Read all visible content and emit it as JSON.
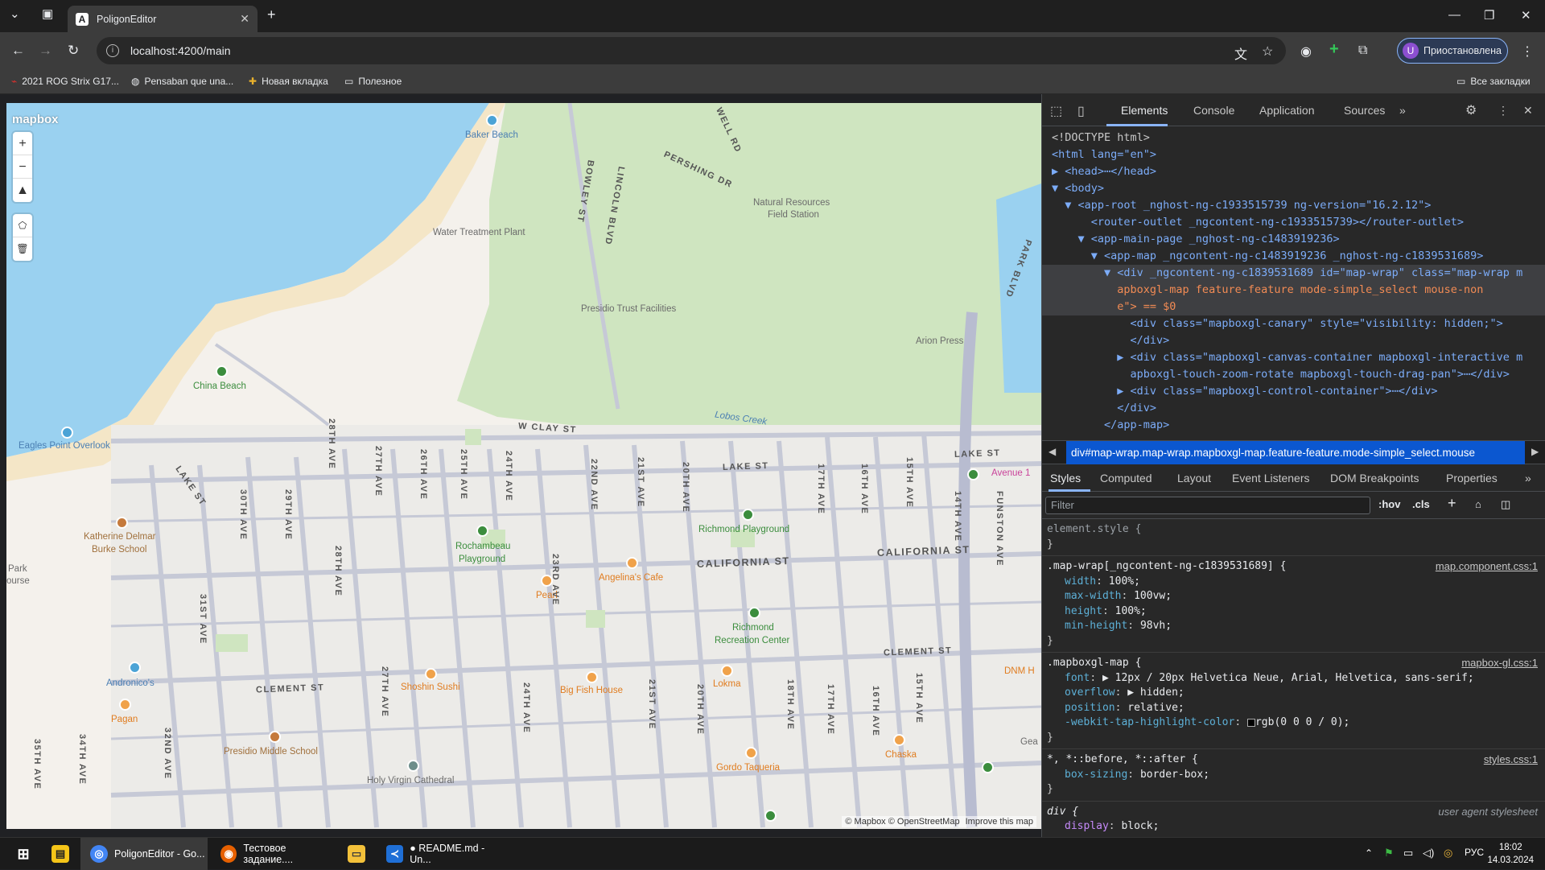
{
  "browser": {
    "tab_title": "PoligonEditor",
    "address": "localhost:4200/main",
    "profile_label": "Приостановлена",
    "profile_initial": "U",
    "bookmarks": [
      "2021 ROG Strix G17...",
      "Pensaban que una...",
      "Новая вкладка",
      "Полезное"
    ],
    "all_bookmarks": "Все закладки"
  },
  "map": {
    "logo": "mapbox",
    "attribution": "© Mapbox © OpenStreetMap",
    "improve": "Improve this map",
    "places": [
      "Baker Beach",
      "Water Treatment Plant",
      "Natural Resources",
      "Field Station",
      "Presidio Trust Facilities",
      "Arion Press",
      "China Beach",
      "Lobos Creek",
      "Eagles Point Overlook",
      "Katherine Delmar",
      "Burke School",
      "Rochambeau",
      "Playground",
      "Richmond Playground",
      "Angelina's Cafe",
      "Pearl",
      "Richmond",
      "Recreation Center",
      "Andronico's",
      "Pagan",
      "Shoshin Sushi",
      "Big Fish House",
      "Lokma",
      "Chaska",
      "Presidio Middle School",
      "Holy Virgin Cathedral",
      "Gordo Taqueria",
      "Avenue 1",
      "DNM H",
      "Park",
      "ourse",
      "Gea"
    ],
    "streets_h": [
      "W CLAY ST",
      "LAKE ST",
      "LAKE ST",
      "CALIFORNIA ST",
      "CALIFORNIA ST",
      "CLEMENT ST",
      "CLEMENT ST",
      "LAKE ST"
    ],
    "streets_v": [
      "LINCOLN BLVD",
      "BOWLEY ST",
      "PERSHING DR",
      "WELL RD",
      "PARK BLVD",
      "28TH AVE",
      "27TH AVE",
      "26TH AVE",
      "25TH AVE",
      "24TH AVE",
      "22ND AVE",
      "21ST AVE",
      "20TH AVE",
      "17TH AVE",
      "16TH AVE",
      "15TH AVE",
      "14TH AVE",
      "FUNSTON AVE",
      "30TH AVE",
      "29TH AVE",
      "28TH AVE",
      "23RD AVE",
      "31ST AVE",
      "27TH AVE",
      "24TH AVE",
      "21ST AVE",
      "20TH AVE",
      "18TH AVE",
      "17TH AVE",
      "16TH AVE",
      "15TH AVE",
      "35TH AVE",
      "34TH AVE",
      "32ND AVE"
    ]
  },
  "devtools": {
    "tabs": [
      "Elements",
      "Console",
      "Application",
      "Sources"
    ],
    "breadcrumb": "div#map-wrap.map-wrap.mapboxgl-map.feature-feature.mode-simple_select.mouse",
    "subtabs": [
      "Styles",
      "Computed",
      "Layout",
      "Event Listeners",
      "DOM Breakpoints",
      "Properties"
    ],
    "filter_placeholder": "Filter",
    "hov": ":hov",
    "cls": ".cls",
    "dom": [
      "<!DOCTYPE html>",
      "<html lang=\"en\">",
      "▶ <head>⋯</head>",
      "▼ <body>",
      "  ▼ <app-root _nghost-ng-c1933515739 ng-version=\"16.2.12\">",
      "      <router-outlet _ngcontent-ng-c1933515739></router-outlet>",
      "    ▼ <app-main-page _nghost-ng-c1483919236>",
      "      ▼ <app-map _ngcontent-ng-c1483919236 _nghost-ng-c1839531689>",
      "        ▼ <div _ngcontent-ng-c1839531689 id=\"map-wrap\" class=\"map-wrap m",
      "          apboxgl-map feature-feature mode-simple_select mouse-non",
      "          e\"> == $0",
      "            <div class=\"mapboxgl-canary\" style=\"visibility: hidden;\">",
      "            </div>",
      "          ▶ <div class=\"mapboxgl-canvas-container mapboxgl-interactive m",
      "            apboxgl-touch-zoom-rotate mapboxgl-touch-drag-pan\">⋯</div>",
      "          ▶ <div class=\"mapboxgl-control-container\">⋯</div>",
      "          </div>",
      "        </app-map>"
    ],
    "styles": [
      {
        "selector": "element.style {",
        "source": "",
        "props": []
      },
      {
        "selector": ".map-wrap[_ngcontent-ng-c1839531689] {",
        "source": "map.component.css:1",
        "props": [
          [
            "width",
            "100%;"
          ],
          [
            "max-width",
            "100vw;"
          ],
          [
            "height",
            "100%;"
          ],
          [
            "min-height",
            "98vh;"
          ]
        ]
      },
      {
        "selector": ".mapboxgl-map {",
        "source": "mapbox-gl.css:1",
        "props": [
          [
            "font",
            "▶ 12px / 20px Helvetica Neue, Arial, Helvetica, sans-serif;"
          ],
          [
            "overflow",
            "▶ hidden;"
          ],
          [
            "position",
            "relative;"
          ],
          [
            "-webkit-tap-highlight-color",
            "rgb(0 0 0 / 0);"
          ]
        ]
      },
      {
        "selector": "*, *::before, *::after {",
        "source": "styles.css:1",
        "props": [
          [
            "box-sizing",
            "border-box;"
          ]
        ]
      },
      {
        "selector": "div {",
        "source": "user agent stylesheet",
        "props": [
          [
            "display",
            "block;"
          ]
        ]
      }
    ]
  },
  "taskbar": {
    "items": [
      "PoligonEditor - Go...",
      "Тестовое задание....",
      "",
      "● README.md - Un..."
    ],
    "lang": "РУС",
    "time": "18:02",
    "date": "14.03.2024"
  }
}
